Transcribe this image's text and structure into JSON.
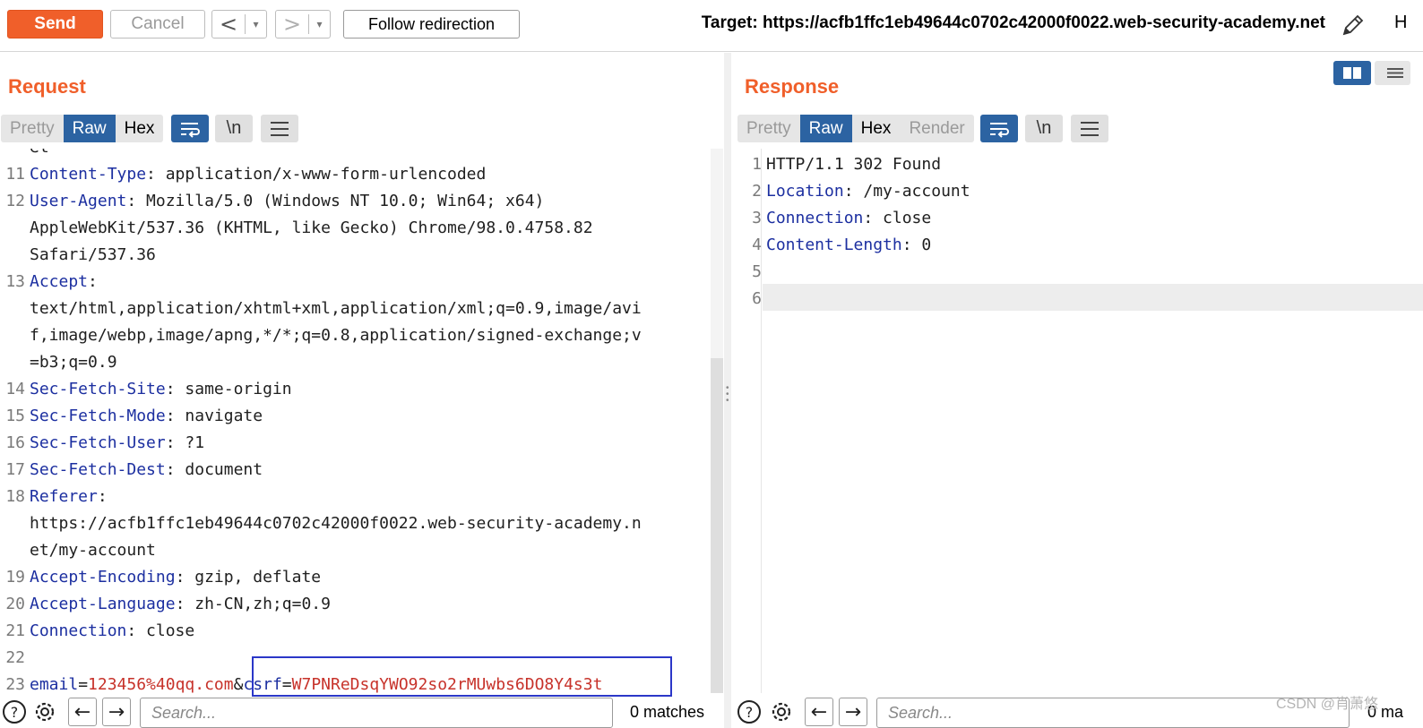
{
  "toolbar": {
    "send_label": "Send",
    "cancel_label": "Cancel",
    "back_glyph": "<",
    "forward_glyph": ">",
    "dropdown_glyph": "▾",
    "follow_label": "Follow redirection",
    "target_text": "Target: https://acfb1ffc1eb49644c0702c42000f0022.web-security-academy.net",
    "trailing_glyph": "H"
  },
  "request": {
    "title": "Request",
    "tabs": [
      "Pretty",
      "Raw",
      "Hex"
    ],
    "active_tab": "Raw",
    "newline_glyph": "\\n",
    "lines": [
      {
        "n": "",
        "k": "",
        "v": "et"
      },
      {
        "n": "11",
        "k": "Content-Type",
        "v": ": application/x-www-form-urlencoded"
      },
      {
        "n": "12",
        "k": "User-Agent",
        "v": ": Mozilla/5.0 (Windows NT 10.0; Win64; x64)"
      },
      {
        "n": "",
        "k": "",
        "v": "AppleWebKit/537.36 (KHTML, like Gecko) Chrome/98.0.4758.82"
      },
      {
        "n": "",
        "k": "",
        "v": "Safari/537.36"
      },
      {
        "n": "13",
        "k": "Accept",
        "v": ":"
      },
      {
        "n": "",
        "k": "",
        "v": "text/html,application/xhtml+xml,application/xml;q=0.9,image/avi"
      },
      {
        "n": "",
        "k": "",
        "v": "f,image/webp,image/apng,*/*;q=0.8,application/signed-exchange;v"
      },
      {
        "n": "",
        "k": "",
        "v": "=b3;q=0.9"
      },
      {
        "n": "14",
        "k": "Sec-Fetch-Site",
        "v": ": same-origin"
      },
      {
        "n": "15",
        "k": "Sec-Fetch-Mode",
        "v": ": navigate"
      },
      {
        "n": "16",
        "k": "Sec-Fetch-User",
        "v": ": ?1"
      },
      {
        "n": "17",
        "k": "Sec-Fetch-Dest",
        "v": ": document"
      },
      {
        "n": "18",
        "k": "Referer",
        "v": ":"
      },
      {
        "n": "",
        "k": "",
        "v": "https://acfb1ffc1eb49644c0702c42000f0022.web-security-academy.n"
      },
      {
        "n": "",
        "k": "",
        "v": "et/my-account"
      },
      {
        "n": "19",
        "k": "Accept-Encoding",
        "v": ": gzip, deflate"
      },
      {
        "n": "20",
        "k": "Accept-Language",
        "v": ": zh-CN,zh;q=0.9"
      },
      {
        "n": "21",
        "k": "Connection",
        "v": ": close"
      },
      {
        "n": "22",
        "k": "",
        "v": ""
      }
    ],
    "body_line": {
      "n": "23",
      "p1_name": "email",
      "p1_eq": "=",
      "p1_value": "123456%40qq.com",
      "amp": "&",
      "p2_name": "csrf",
      "p2_eq": "=",
      "p2_value": "W7PNReDsqYWO92so2rMUwbs6DO8Y4s3t"
    },
    "search_placeholder": "Search...",
    "matches": "0 matches"
  },
  "response": {
    "title": "Response",
    "tabs": [
      "Pretty",
      "Raw",
      "Hex",
      "Render"
    ],
    "active_tab": "Raw",
    "newline_glyph": "\\n",
    "lines": [
      {
        "n": "1",
        "k": "",
        "v": "HTTP/1.1 302 Found"
      },
      {
        "n": "2",
        "k": "Location",
        "v": ": /my-account"
      },
      {
        "n": "3",
        "k": "Connection",
        "v": ": close"
      },
      {
        "n": "4",
        "k": "Content-Length",
        "v": ": 0"
      },
      {
        "n": "5",
        "k": "",
        "v": ""
      },
      {
        "n": "6",
        "k": "",
        "v": ""
      }
    ],
    "search_placeholder": "Search...",
    "matches": "0 ma"
  },
  "icons": {
    "help": "help-icon",
    "settings": "gear-icon",
    "back": "arrow-left-icon",
    "forward": "arrow-right-icon",
    "wrap": "wrap-icon",
    "menu": "hamburger-icon",
    "edit": "pencil-icon"
  },
  "colors": {
    "accent_orange": "#f05f2a",
    "active_blue": "#2c63a2",
    "header_name_blue": "#1c2fa0",
    "param_value_red": "#c7322a",
    "highlight_box": "#2b37c8"
  },
  "watermark": "CSDN @肖萧悠"
}
